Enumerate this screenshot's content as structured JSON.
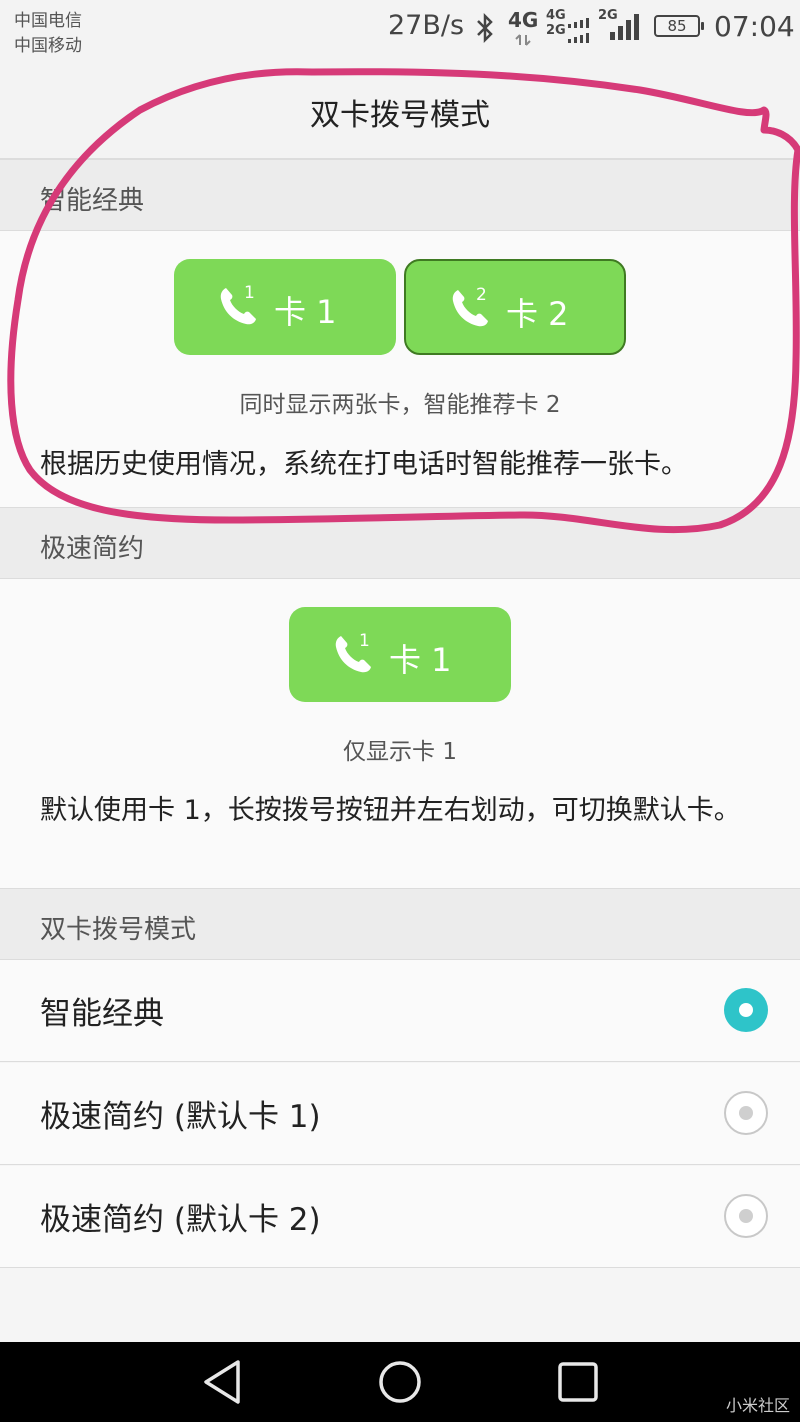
{
  "status_bar": {
    "carrier_1": "中国电信",
    "carrier_2": "中国移动",
    "net_speed": "27B/s",
    "net_4g": "4G",
    "net_4g_small": "4G",
    "net_2g_small": "2G",
    "net_2g": "2G",
    "battery": "85",
    "time": "07:04",
    "icons": [
      "bluetooth-icon",
      "signal-icon",
      "battery-icon"
    ]
  },
  "header": {
    "title": "双卡拨号模式"
  },
  "smart_classic": {
    "heading": "智能经典",
    "card1": {
      "sup": "1",
      "label": "卡 1"
    },
    "card2": {
      "sup": "2",
      "label": "卡 2",
      "selected": true
    },
    "hint": "同时显示两张卡，智能推荐卡 2",
    "description": "根据历史使用情况，系统在打电话时智能推荐一张卡。"
  },
  "fast_simple": {
    "heading": "极速简约",
    "card1": {
      "sup": "1",
      "label": "卡 1"
    },
    "hint": "仅显示卡 1",
    "description": "默认使用卡 1，长按拨号按钮并左右划动，可切换默认卡。"
  },
  "mode_list": {
    "heading": "双卡拨号模式",
    "options": [
      {
        "label": "智能经典",
        "selected": true
      },
      {
        "label": "极速简约 (默认卡 1)",
        "selected": false
      },
      {
        "label": "极速简约 (默认卡 2)",
        "selected": false
      }
    ]
  },
  "nav_bar": {
    "icons": [
      "back-icon",
      "home-icon",
      "recents-icon"
    ]
  },
  "watermark": "小米社区",
  "colors": {
    "accent_green": "#7ed957",
    "radio_teal": "#2ec4c9",
    "annotation_pink": "#d63a78"
  }
}
